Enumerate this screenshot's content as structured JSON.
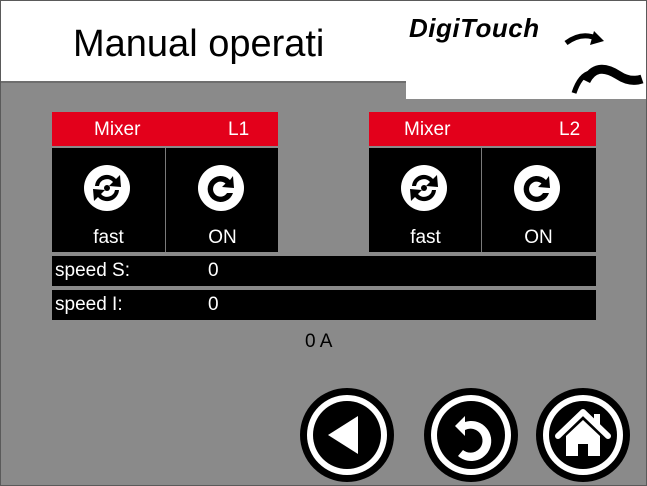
{
  "header": {
    "title": "Manual operati",
    "logo_text": "DigiTouch"
  },
  "mixers": [
    {
      "name": "Mixer",
      "line": "L1",
      "speed_mode": "fast",
      "state": "ON",
      "speed_icon": "rotation-arrows-icon",
      "state_icon": "circular-arrow-icon"
    },
    {
      "name": "Mixer",
      "line": "L2",
      "speed_mode": "fast",
      "state": "ON",
      "speed_icon": "rotation-arrows-icon",
      "state_icon": "circular-arrow-icon"
    }
  ],
  "readouts": [
    {
      "label": "speed S:",
      "value": "0"
    },
    {
      "label": "speed I:",
      "value": "0"
    }
  ],
  "current": "0 A",
  "nav": [
    "back-icon",
    "return-icon",
    "home-icon"
  ],
  "colors": {
    "accent": "#e3001b",
    "background": "#8a8a8a",
    "panel": "#000000"
  }
}
